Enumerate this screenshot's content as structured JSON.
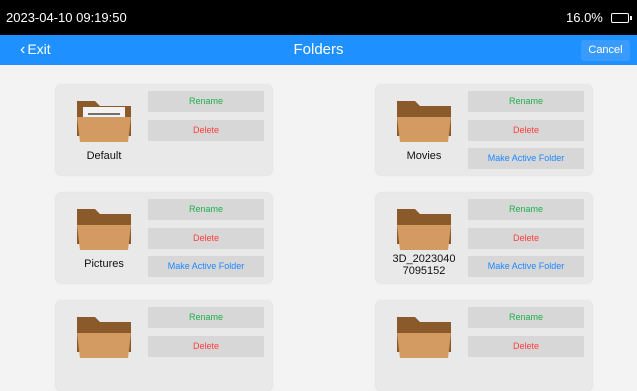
{
  "status_bar": {
    "time": "2023-04-10 09:19:50",
    "battery": "16.0%"
  },
  "nav": {
    "back_label": "Exit",
    "title": "Folders",
    "cancel_label": "Cancel"
  },
  "labels": {
    "rename": "Rename",
    "delete": "Delete",
    "make_active": "Make Active Folder"
  },
  "folders": [
    {
      "name": "Default",
      "active": true
    },
    {
      "name": "Movies",
      "active": false
    },
    {
      "name": "Pictures",
      "active": false
    },
    {
      "name": "3D_2023040\n7095152",
      "active": false
    },
    {
      "name": "",
      "active": false
    },
    {
      "name": "",
      "active": false
    }
  ],
  "colors": {
    "nav": "#1e90ff",
    "rename": "#1eb04a",
    "delete": "#ff3b3b",
    "make_active": "#1e88ff"
  }
}
